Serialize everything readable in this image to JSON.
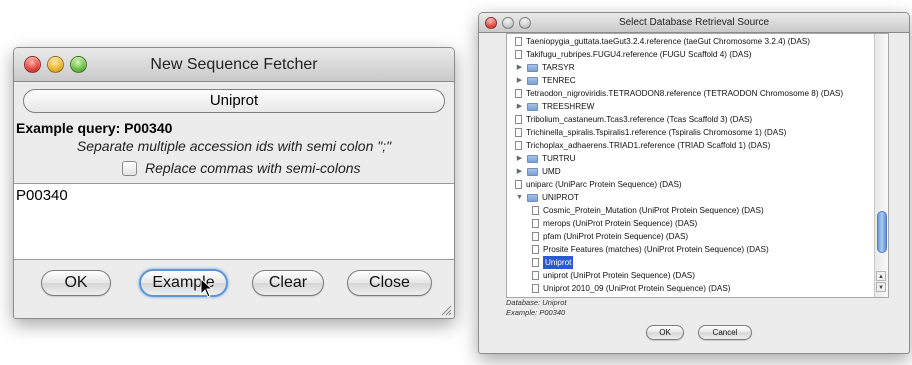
{
  "fetcher": {
    "title": "New Sequence Fetcher",
    "source": "Uniprot",
    "example_query": "Example query: P00340",
    "separator_hint": "Separate multiple accession ids with semi colon \";\"",
    "replace_label": "Replace commas with semi-colons",
    "replace_checked": false,
    "query_value": "P00340",
    "buttons": {
      "ok": "OK",
      "example": "Example",
      "clear": "Clear",
      "close": "Close"
    }
  },
  "db_source": {
    "title": "Select Database Retrieval Source",
    "tree": [
      {
        "label": "Taeniopygia_guttata.taeGut3.2.4.reference (taeGut Chromosome 3.2.4) (DAS)",
        "kind": "doc",
        "level": 1
      },
      {
        "label": "Takifugu_rubripes.FUGU4.reference (FUGU Scaffold 4) (DAS)",
        "kind": "doc",
        "level": 1
      },
      {
        "label": "TARSYR",
        "kind": "folder",
        "level": 0,
        "expanded": false
      },
      {
        "label": "TENREC",
        "kind": "folder",
        "level": 0,
        "expanded": false
      },
      {
        "label": "Tetraodon_nigroviridis.TETRAODON8.reference (TETRAODON Chromosome 8) (DAS)",
        "kind": "doc",
        "level": 1
      },
      {
        "label": "TREESHREW",
        "kind": "folder",
        "level": 0,
        "expanded": false
      },
      {
        "label": "Tribolium_castaneum.Tcas3.reference (Tcas Scaffold 3) (DAS)",
        "kind": "doc",
        "level": 1
      },
      {
        "label": "Trichinella_spiralis.Tspiralis1.reference (Tspiralis Chromosome 1) (DAS)",
        "kind": "doc",
        "level": 1
      },
      {
        "label": "Trichoplax_adhaerens.TRIAD1.reference (TRIAD Scaffold 1) (DAS)",
        "kind": "doc",
        "level": 1
      },
      {
        "label": "TURTRU",
        "kind": "folder",
        "level": 0,
        "expanded": false
      },
      {
        "label": "UMD",
        "kind": "folder",
        "level": 0,
        "expanded": false
      },
      {
        "label": "uniparc (UniParc Protein Sequence) (DAS)",
        "kind": "doc",
        "level": 1
      },
      {
        "label": "UNIPROT",
        "kind": "folder",
        "level": 0,
        "expanded": true
      },
      {
        "label": "Cosmic_Protein_Mutation (UniProt Protein Sequence) (DAS)",
        "kind": "doc",
        "level": 2
      },
      {
        "label": "merops (UniProt Protein Sequence) (DAS)",
        "kind": "doc",
        "level": 2
      },
      {
        "label": "pfam (UniProt Protein Sequence) (DAS)",
        "kind": "doc",
        "level": 2
      },
      {
        "label": "Prosite Features (matches) (UniProt Protein Sequence) (DAS)",
        "kind": "doc",
        "level": 2
      },
      {
        "label": "Uniprot",
        "kind": "doc",
        "level": 2,
        "selected": true
      },
      {
        "label": "uniprot (UniProt Protein Sequence) (DAS)",
        "kind": "doc",
        "level": 2
      },
      {
        "label": "Uniprot 2010_09 (UniProt Protein Sequence) (DAS)",
        "kind": "doc",
        "level": 2
      }
    ],
    "database_line": "Database: Uniprot",
    "example_line": "Example: P00340",
    "buttons": {
      "ok": "OK",
      "cancel": "Cancel"
    }
  },
  "colors": {
    "selection": "#2a59d6",
    "focus_ring": "#5f95d6"
  }
}
